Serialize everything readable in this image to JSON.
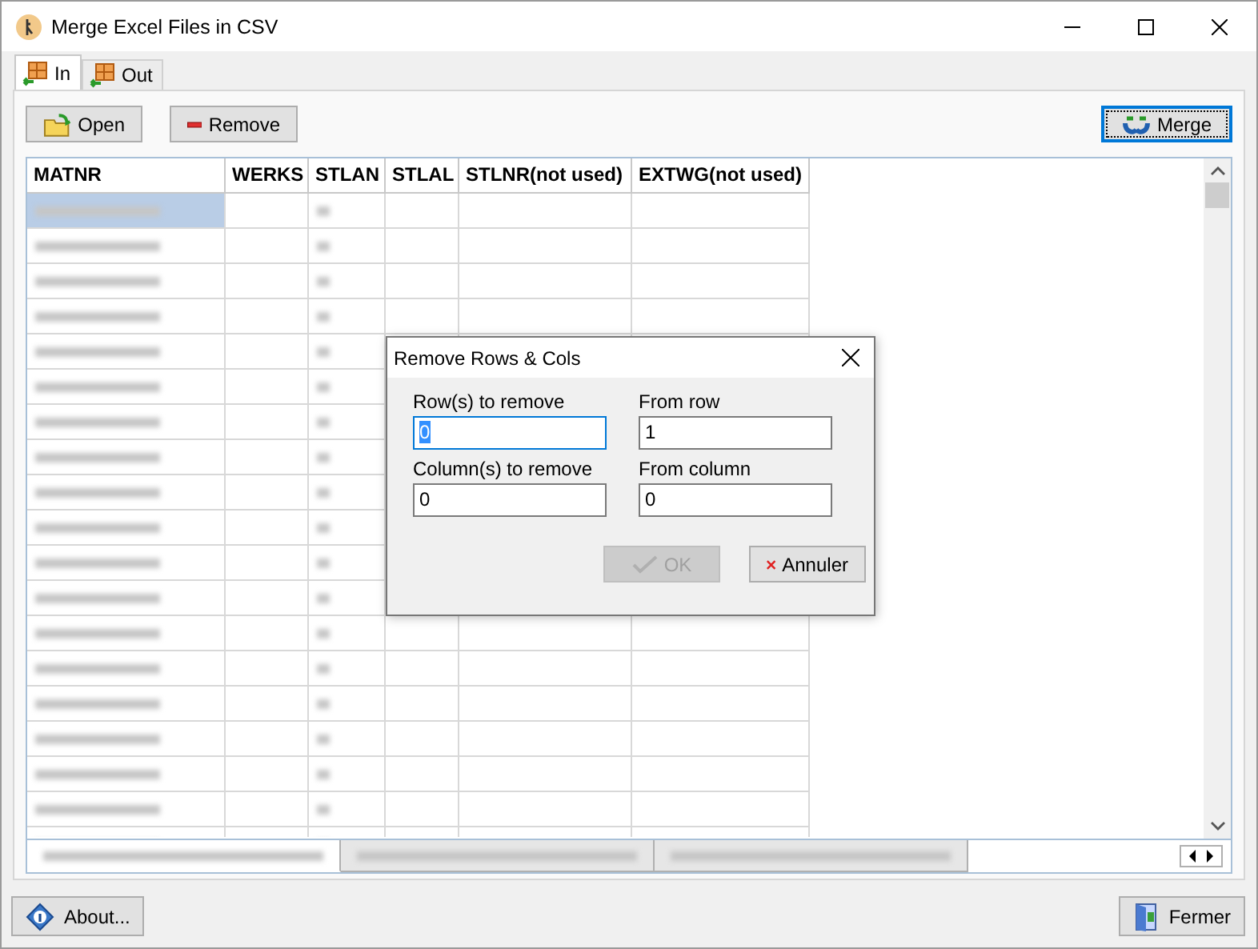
{
  "window": {
    "title": "Merge Excel Files in CSV"
  },
  "tabs": [
    {
      "label": "In",
      "selected": true
    },
    {
      "label": "Out",
      "selected": false
    }
  ],
  "toolbar": [
    {
      "label": "Open",
      "kind": "open",
      "focused": false
    },
    {
      "label": "Remove",
      "kind": "remove",
      "focused": false
    },
    {
      "label": "Merge",
      "kind": "merge",
      "focused": true
    }
  ],
  "table": {
    "columns": [
      "MATNR",
      "WERKS",
      "STLAN",
      "STLAL",
      "STLNR(not used)",
      "EXTWG(not used)"
    ],
    "rows": [
      {
        "selected": true
      },
      {
        "selected": false
      },
      {
        "selected": false
      },
      {
        "selected": false
      },
      {
        "selected": false
      },
      {
        "selected": false
      },
      {
        "selected": false
      },
      {
        "selected": false
      },
      {
        "selected": false
      },
      {
        "selected": false
      },
      {
        "selected": false
      },
      {
        "selected": false
      },
      {
        "selected": false
      },
      {
        "selected": false
      },
      {
        "selected": false
      },
      {
        "selected": false
      },
      {
        "selected": false
      },
      {
        "selected": false
      },
      {
        "selected": false
      }
    ]
  },
  "sheet_tabs": [
    {
      "selected": true
    },
    {
      "selected": false
    },
    {
      "selected": false
    }
  ],
  "dialog": {
    "title": "Remove Rows & Cols",
    "fields": [
      {
        "label": "Row(s) to remove",
        "value": "0",
        "focused": true
      },
      {
        "label": "From row",
        "value": "1",
        "focused": false
      },
      {
        "label": "Column(s) to remove",
        "value": "0",
        "focused": false
      },
      {
        "label": "From column",
        "value": "0",
        "focused": false
      }
    ],
    "buttons": [
      {
        "label": "OK",
        "kind": "ok",
        "disabled": true
      },
      {
        "label": "Annuler",
        "kind": "cancel",
        "disabled": false
      }
    ]
  },
  "footer": [
    {
      "label": "About...",
      "kind": "about"
    },
    {
      "label": "Fermer",
      "kind": "close"
    }
  ]
}
